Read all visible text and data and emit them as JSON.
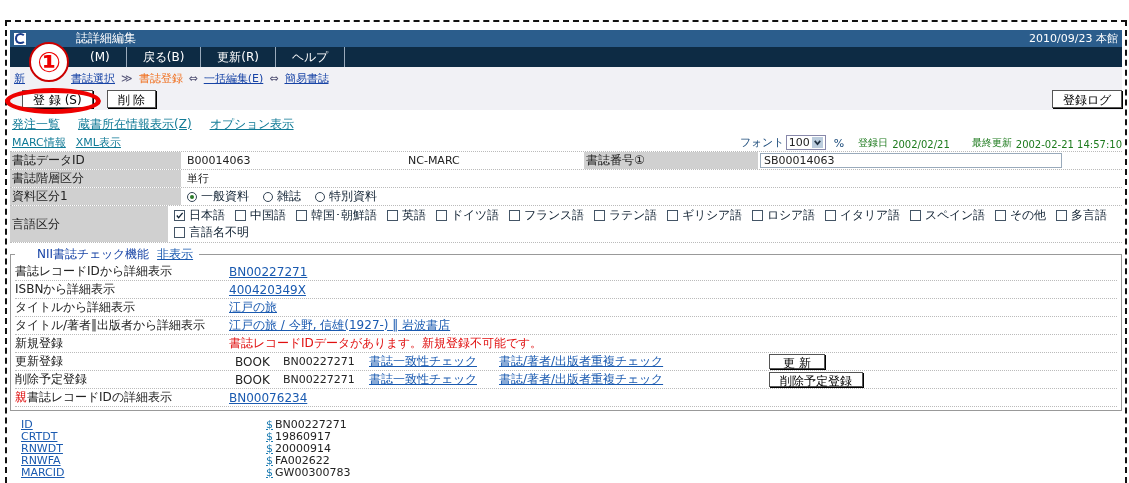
{
  "window": {
    "title": "誌詳細編集",
    "datetime": "2010/09/23 本館"
  },
  "menu": [
    "(M)",
    "戻る(B)",
    "更新(R)",
    "ヘルプ"
  ],
  "annotation": {
    "number": "①"
  },
  "breadcrumb": [
    {
      "label": "新",
      "kind": "link"
    },
    {
      "label": "書誌選択",
      "kind": "link"
    },
    {
      "label": "≫",
      "kind": "sep"
    },
    {
      "label": "書誌登録",
      "kind": "current"
    },
    {
      "label": "⇔",
      "kind": "sep"
    },
    {
      "label": "一括編集(E)",
      "kind": "link"
    },
    {
      "label": "⇔",
      "kind": "sep"
    },
    {
      "label": "簡易書誌",
      "kind": "link"
    }
  ],
  "actions": {
    "register": "登 録 (S)",
    "delete": "削 除",
    "log": "登録ログ"
  },
  "links": [
    "発注一覧",
    "蔵書所在情報表示(Z)",
    "オプション表示"
  ],
  "links2": [
    "MARC情報",
    "XML表示"
  ],
  "font": {
    "label": "フォント",
    "value": "100",
    "unit": "%"
  },
  "dates": {
    "registered_label": "登録日",
    "registered": "2002/02/21",
    "updated_label": "最終更新",
    "updated": "2002-02-21 14:57:10"
  },
  "record": {
    "id_label": "書誌データID",
    "id": "B00014063",
    "source": "NC-MARC",
    "number_label": "書誌番号①",
    "number": "SB00014063",
    "level_label": "書誌階層区分",
    "level_value": "単行",
    "type_label": "資料区分1",
    "lang_label": "言語区分"
  },
  "types": [
    {
      "label": "一般資料",
      "selected": true
    },
    {
      "label": "雑誌",
      "selected": false
    },
    {
      "label": "特別資料",
      "selected": false
    }
  ],
  "languages": [
    {
      "label": "日本語",
      "checked": true
    },
    {
      "label": "中国語",
      "checked": false
    },
    {
      "label": "韓国･朝鮮語",
      "checked": false
    },
    {
      "label": "英語",
      "checked": false
    },
    {
      "label": "ドイツ語",
      "checked": false
    },
    {
      "label": "フランス語",
      "checked": false
    },
    {
      "label": "ラテン語",
      "checked": false
    },
    {
      "label": "ギリシア語",
      "checked": false
    },
    {
      "label": "ロシア語",
      "checked": false
    },
    {
      "label": "イタリア語",
      "checked": false
    },
    {
      "label": "スペイン語",
      "checked": false
    },
    {
      "label": "その他",
      "checked": false
    },
    {
      "label": "多言語",
      "checked": false
    },
    {
      "label": "言語名不明",
      "checked": false
    }
  ],
  "nii": {
    "title": "NII書誌チェック機能",
    "hide": "非表示",
    "rows": [
      {
        "kind": "link",
        "label": "書誌レコードIDから詳細表示",
        "value": "BN00227271"
      },
      {
        "kind": "link",
        "label": "ISBNから詳細表示",
        "value": "400420349X"
      },
      {
        "kind": "link",
        "label": "タイトルから詳細表示",
        "value": "江戸の旅"
      },
      {
        "kind": "link",
        "label": "タイトル/著者‖出版者から詳細表示",
        "value": "江戸の旅 / 今野, 信雄(1927-) ‖ 岩波書店"
      },
      {
        "kind": "error",
        "label": "新規登録",
        "value": "書誌レコードIDデータがあります。新規登録不可能です。"
      },
      {
        "kind": "action",
        "label": "更新登録",
        "type": "BOOK",
        "id": "BN00227271",
        "check1": "書誌一致性チェック",
        "check2": "書誌/著者/出版者重複チェック",
        "button": "更 新"
      },
      {
        "kind": "action",
        "label": "削除予定登録",
        "type": "BOOK",
        "id": "BN00227271",
        "check1": "書誌一致性チェック",
        "check2": "書誌/著者/出版者重複チェック",
        "button": "削除予定登録"
      },
      {
        "kind": "parent",
        "prefix": "親",
        "label": "書誌レコードIDの詳細表示",
        "value": "BN00076234"
      }
    ]
  },
  "marc": [
    {
      "tag": "ID",
      "value": "BN00227271"
    },
    {
      "tag": "CRTDT",
      "value": "19860917"
    },
    {
      "tag": "RNWDT",
      "value": "20000914"
    },
    {
      "tag": "RNWFA",
      "value": "FA002622"
    },
    {
      "tag": "MARCID",
      "value": "GW00300783"
    }
  ],
  "marc_sign": "$"
}
